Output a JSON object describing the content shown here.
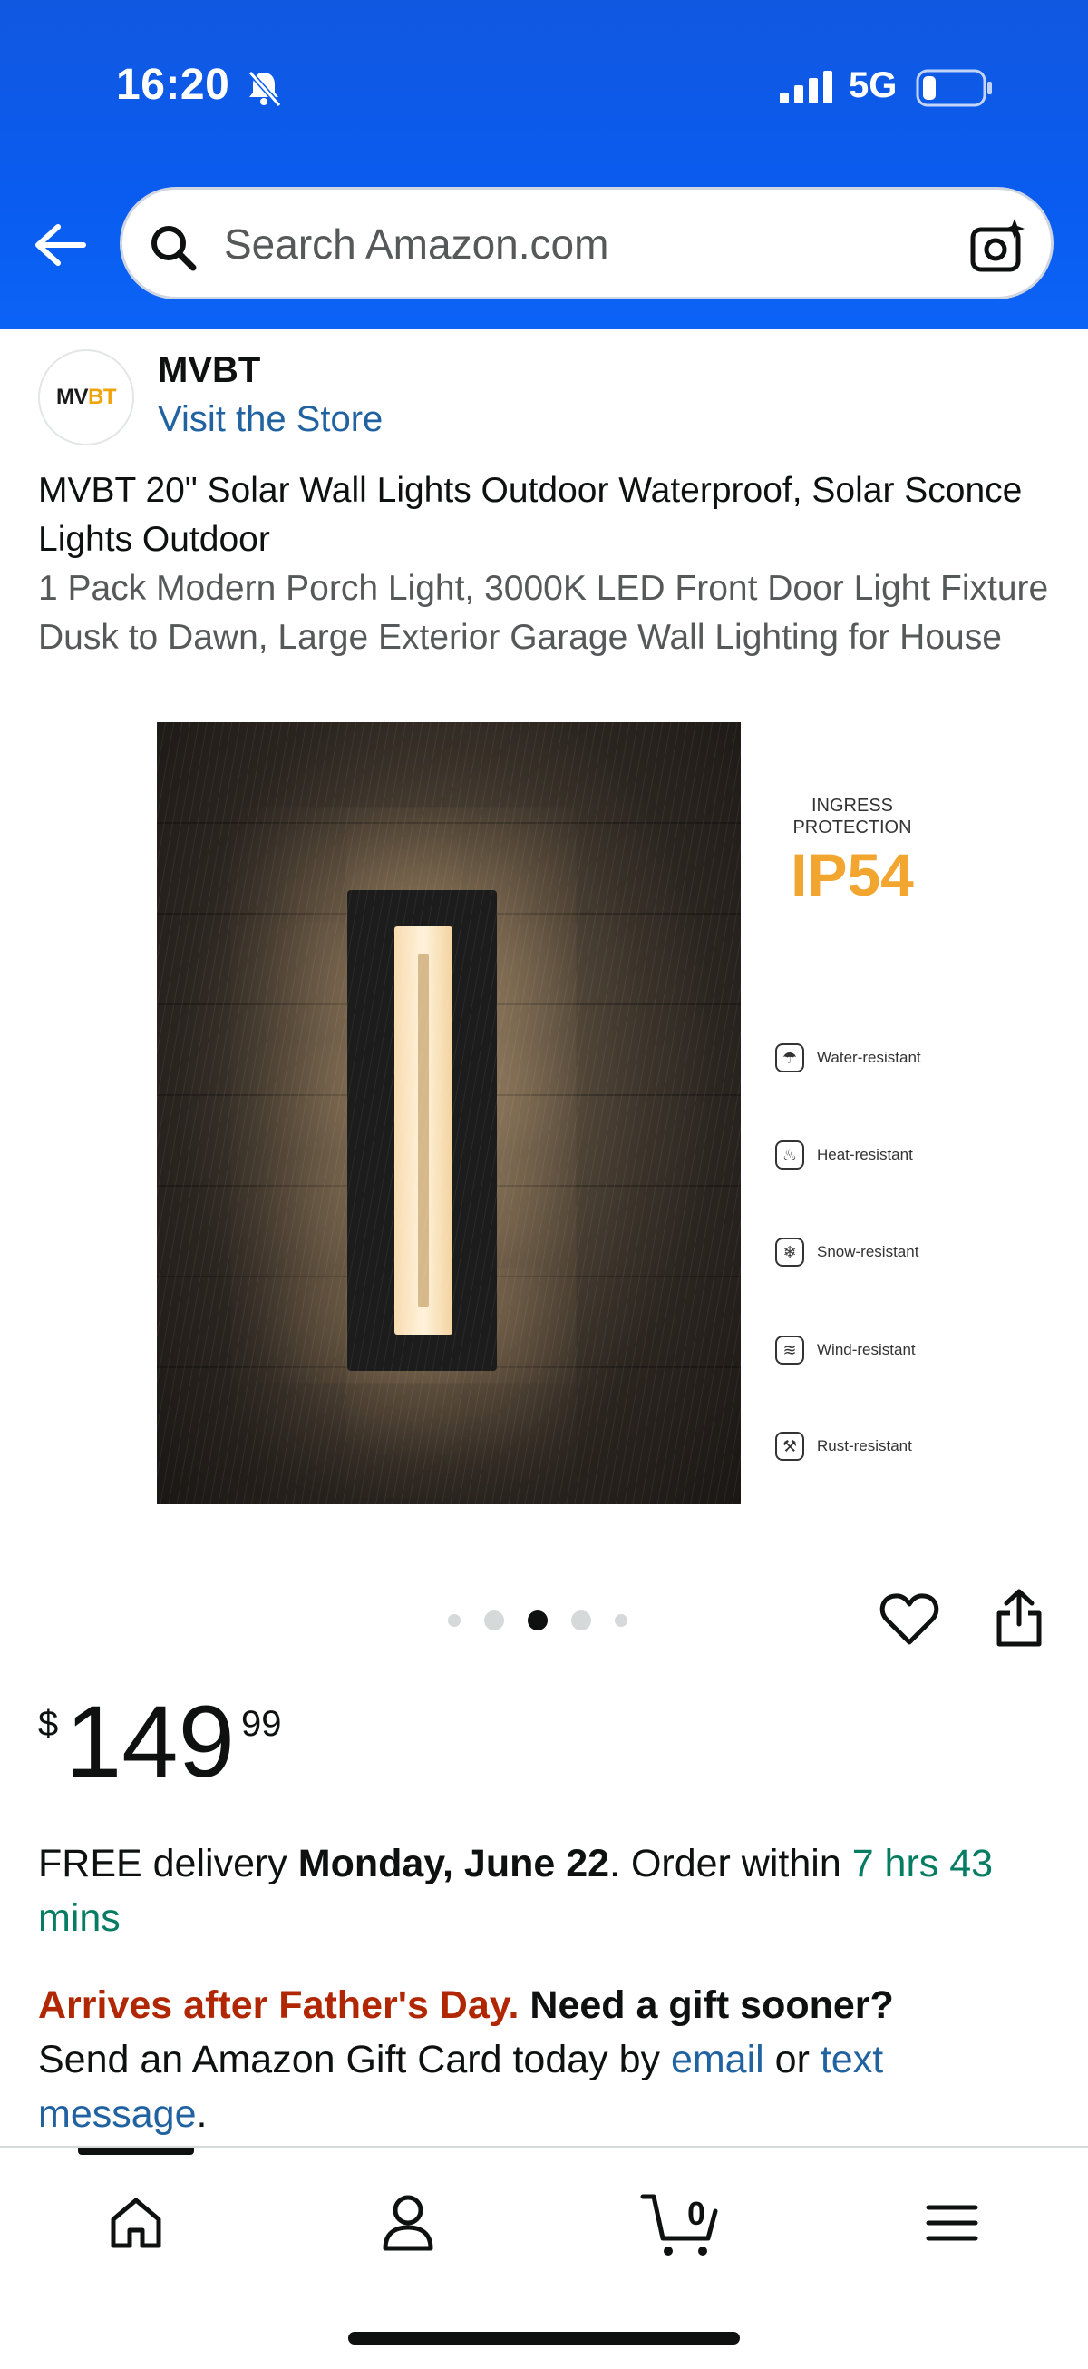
{
  "status_bar": {
    "time": "16:20",
    "network": "5G",
    "icons": [
      "bell-off-icon",
      "signal-icon",
      "battery-icon"
    ]
  },
  "search": {
    "placeholder": "Search Amazon.com",
    "icons": [
      "back-arrow-icon",
      "search-icon",
      "camera-icon"
    ]
  },
  "brand": {
    "logo_text_a": "MV",
    "logo_text_b": "BT",
    "name": "MVBT",
    "store_link": "Visit the Store"
  },
  "product": {
    "title": "MVBT 20\" Solar Wall Lights Outdoor Waterproof, Solar Sconce Lights Outdoor",
    "subtitle": "1 Pack Modern Porch Light, 3000K LED Front Door Light Fixture Dusk to Dawn, Large Exterior Garage Wall Lighting for House"
  },
  "image_overlay": {
    "heading": "INGRESS PROTECTION",
    "rating": "IP54",
    "rating_color": "#f2a630",
    "features": [
      {
        "label": "Water-resistant",
        "icon": "umbrella-icon"
      },
      {
        "label": "Heat-resistant",
        "icon": "heat-icon"
      },
      {
        "label": "Snow-resistant",
        "icon": "snowflake-icon"
      },
      {
        "label": "Wind-resistant",
        "icon": "wind-icon"
      },
      {
        "label": "Rust-resistant",
        "icon": "rust-icon"
      }
    ]
  },
  "carousel": {
    "dot_count": 5,
    "active_index": 2
  },
  "price": {
    "symbol": "$",
    "whole": "149",
    "fraction": "99"
  },
  "delivery": {
    "prefix": "FREE delivery ",
    "date": "Monday, June 22",
    "middle": ". Order within ",
    "countdown": "7 hrs 43 mins"
  },
  "gift_notice": {
    "warning": "Arrives after Father's Day.",
    "question": " Need a gift sooner?",
    "line2_prefix": "Send an Amazon Gift Card today by ",
    "email_link": "email",
    "or": " or ",
    "text_link": "text message",
    "end": "."
  },
  "bottom_nav": {
    "items": [
      "home-icon",
      "account-icon",
      "cart-icon",
      "menu-icon"
    ],
    "cart_count": "0"
  },
  "colors": {
    "header_blue": "#0a5cf0",
    "link_blue": "#2162a1",
    "warning_red": "#b12704",
    "countdown_green": "#067d62"
  }
}
